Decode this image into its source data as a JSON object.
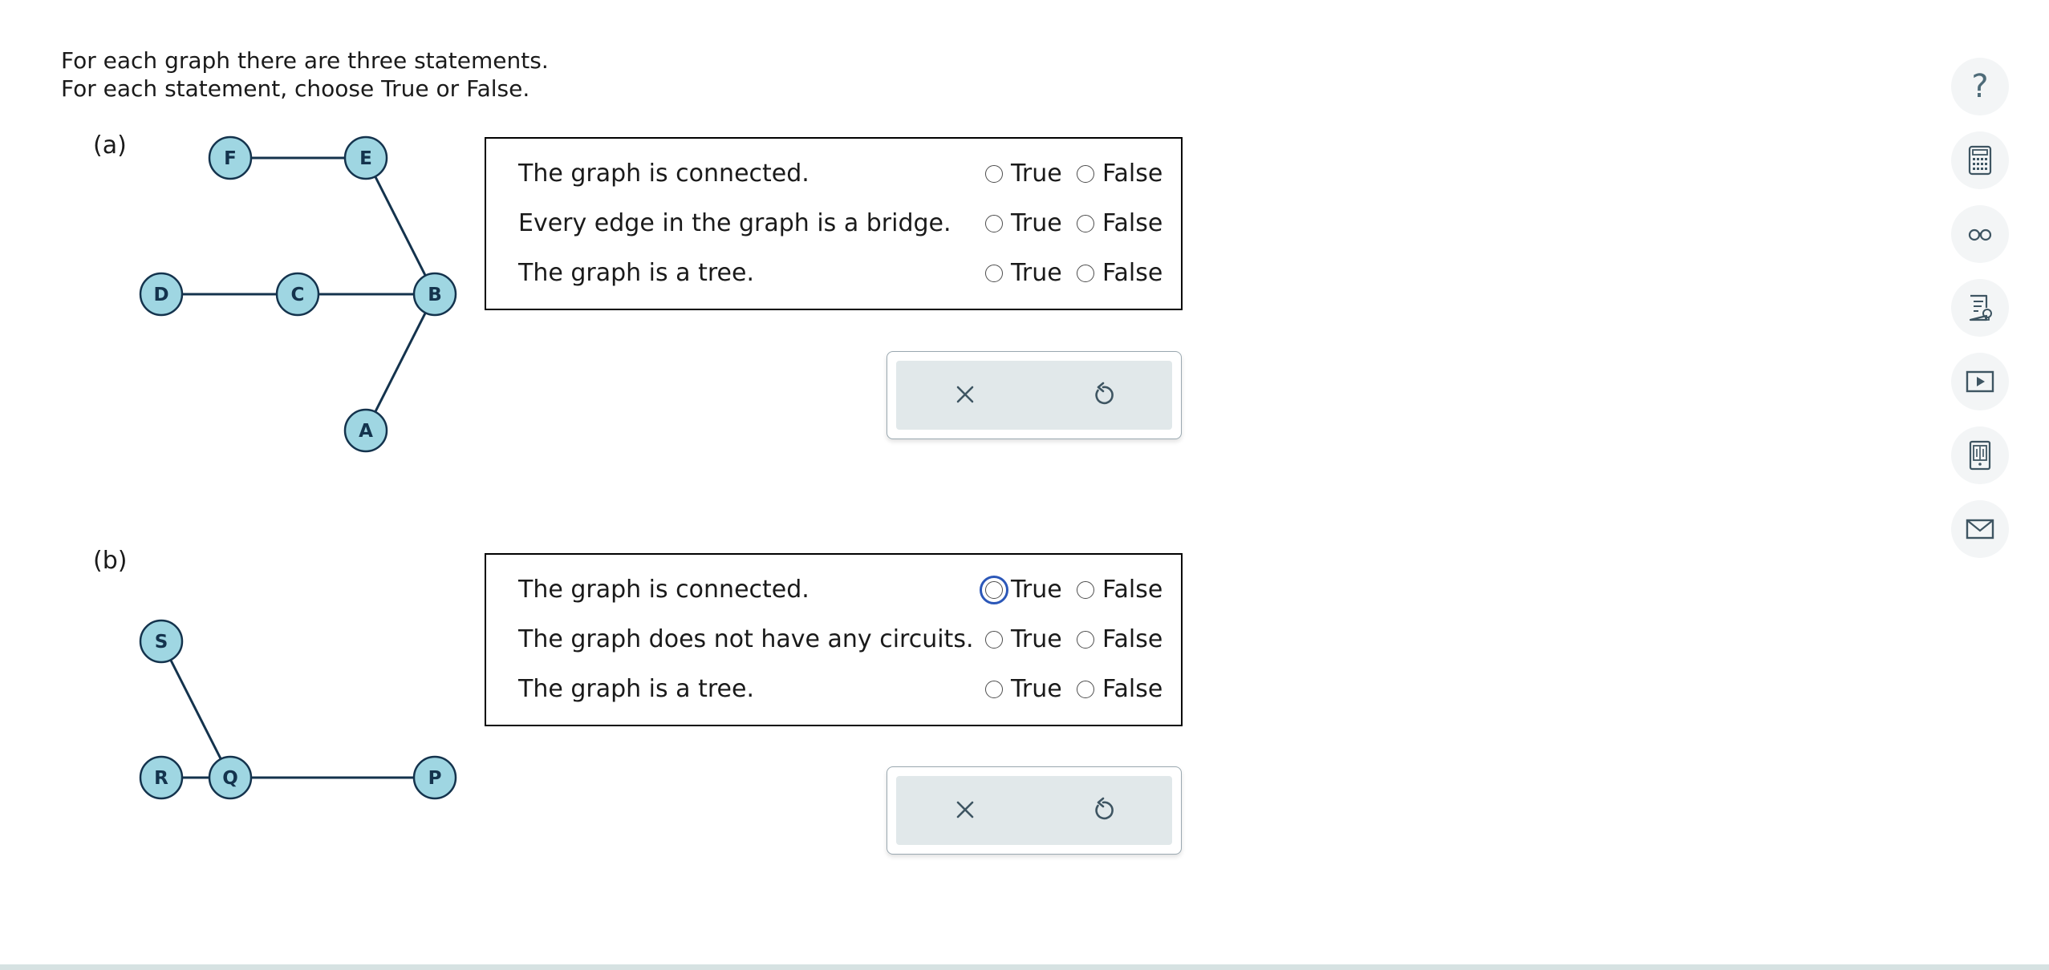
{
  "instructions": {
    "line1": "For each graph there are three statements.",
    "line2": "For each statement, choose True or False."
  },
  "parts": [
    {
      "label": "(a)",
      "graph": {
        "nodes": [
          "F",
          "E",
          "D",
          "C",
          "B",
          "A"
        ],
        "edges": [
          [
            "F",
            "E"
          ],
          [
            "E",
            "B"
          ],
          [
            "D",
            "C"
          ],
          [
            "C",
            "B"
          ],
          [
            "B",
            "A"
          ]
        ]
      },
      "statements": [
        {
          "text": "The graph is connected.",
          "true_label": "True",
          "false_label": "False",
          "selected": null
        },
        {
          "text": "Every edge in the graph is a bridge.",
          "true_label": "True",
          "false_label": "False",
          "selected": null
        },
        {
          "text": "The graph is a tree.",
          "true_label": "True",
          "false_label": "False",
          "selected": null
        }
      ]
    },
    {
      "label": "(b)",
      "graph": {
        "nodes": [
          "S",
          "R",
          "Q",
          "P"
        ],
        "edges": [
          [
            "S",
            "Q"
          ],
          [
            "R",
            "Q"
          ],
          [
            "Q",
            "P"
          ]
        ]
      },
      "statements": [
        {
          "text": "The graph is connected.",
          "true_label": "True",
          "false_label": "False",
          "selected": null,
          "focused": "true"
        },
        {
          "text": "The graph does not have any circuits.",
          "true_label": "True",
          "false_label": "False",
          "selected": null
        },
        {
          "text": "The graph is a tree.",
          "true_label": "True",
          "false_label": "False",
          "selected": null
        }
      ]
    }
  ],
  "actions": {
    "clear_icon": "close-icon",
    "undo_icon": "undo-icon"
  },
  "sidebar": {
    "help_label": "?",
    "tools": [
      "help-icon",
      "calculator-icon",
      "glasses-icon",
      "notes-icon",
      "video-icon",
      "ebook-icon",
      "mail-icon"
    ]
  },
  "colors": {
    "node_fill": "#9fd6e2",
    "node_stroke": "#14334d",
    "action_bg": "#e1e8ea",
    "focus_ring": "#2b57b8"
  }
}
